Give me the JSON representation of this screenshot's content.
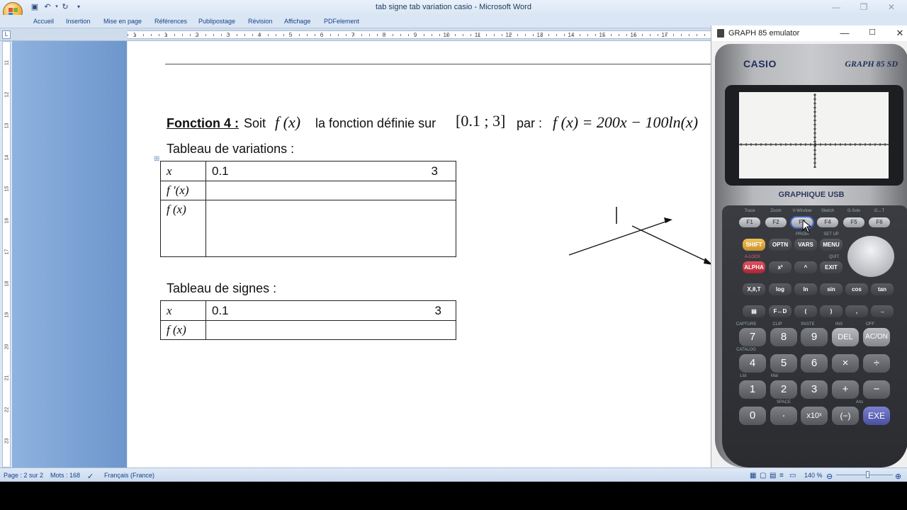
{
  "window": {
    "title": "tab signe tab variation casio - Microsoft Word",
    "controls": [
      "—",
      "❐",
      "✕"
    ]
  },
  "quick_access": [
    "save-icon",
    "undo-icon",
    "redo-icon",
    "customize-icon"
  ],
  "ribbon_tabs": [
    "Accueil",
    "Insertion",
    "Mise en page",
    "Références",
    "Publipostage",
    "Révision",
    "Affichage",
    "PDFelement"
  ],
  "ruler": {
    "h_numbers": [
      "1",
      "1",
      "2",
      "3",
      "4",
      "5",
      "6",
      "7",
      "8",
      "9",
      "10",
      "11",
      "12",
      "13",
      "14",
      "15",
      "16",
      "17"
    ],
    "v_numbers": [
      "11",
      "12",
      "13",
      "14",
      "15",
      "16",
      "17",
      "18",
      "19",
      "20",
      "21",
      "22",
      "23"
    ]
  },
  "document": {
    "fonction_label": "Fonction 4 :",
    "soit": "Soit",
    "fx": "f (x)",
    "definie": "la fonction définie sur",
    "interval": "[0.1 ; 3]",
    "par": "par :",
    "formula": "f (x) = 200x − 100ln(x)",
    "variations_heading": "Tableau de variations :",
    "variations_table": {
      "rows": [
        {
          "label": "x",
          "left": "0.1",
          "right": "3"
        },
        {
          "label": "f '(x)",
          "left": "",
          "right": ""
        },
        {
          "label": "f (x)",
          "left": "",
          "right": ""
        }
      ]
    },
    "signes_heading": "Tableau de signes :",
    "signes_table": {
      "rows": [
        {
          "label": "x",
          "left": "0.1",
          "right": "3"
        },
        {
          "label": "f (x)",
          "left": "",
          "right": ""
        }
      ]
    }
  },
  "statusbar": {
    "page": "Page : 2 sur 2",
    "words": "Mots : 168",
    "language": "Français (France)",
    "zoom": "140 %"
  },
  "emulator": {
    "title": "GRAPH 85 emulator",
    "brand": "CASIO",
    "model": "GRAPH 85 SD",
    "usb_label": "GRAPHIQUE USB",
    "fkey_top_labels": [
      "Trace",
      "Zoom",
      "V-Window",
      "Sketch",
      "G-Solv",
      "G↔T"
    ],
    "fkeys": [
      "F1",
      "F2",
      "F3",
      "F4",
      "F5",
      "F6"
    ],
    "row1_keys": [
      "SHIFT",
      "OPTN",
      "VARS",
      "MENU"
    ],
    "row2_keys": [
      "ALPHA",
      "x²",
      "^",
      "EXIT"
    ],
    "row3_keys": [
      "X,θ,T",
      "log",
      "ln",
      "sin",
      "cos",
      "tan"
    ],
    "row4_keys": [
      "▤",
      "F↔D",
      "(",
      ")",
      ",",
      "→"
    ],
    "num_row1": [
      "7",
      "8",
      "9",
      "DEL",
      "AC/ON"
    ],
    "num_row2": [
      "4",
      "5",
      "6",
      "×",
      "÷"
    ],
    "num_row3": [
      "1",
      "2",
      "3",
      "+",
      "−"
    ],
    "num_row4": [
      "0",
      "·",
      "x10ˣ",
      "(−)",
      "EXE"
    ],
    "small_labels": {
      "prgm": "PRGM",
      "setup": "SET UP",
      "alock": "A-LOCK",
      "quit": "QUIT",
      "capture": "CAPTURE",
      "clip": "CLIP",
      "paste": "PASTE",
      "ins": "INS",
      "off": "OFF",
      "catalog": "CATALOG",
      "list": "List",
      "mat": "Mat",
      "space": "SPACE",
      "ans": "Ans"
    },
    "colors": {
      "exe": "#5c62b4",
      "shift": "#d9a538",
      "alpha": "#c7364a"
    }
  }
}
